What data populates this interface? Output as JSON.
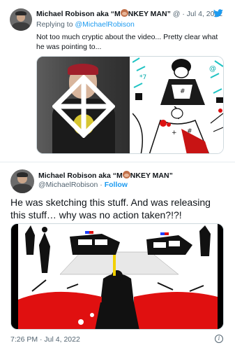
{
  "tweet1": {
    "author_name": "Michael Robison aka “M",
    "author_name_suffix": "NKEY MAN”",
    "handle": "@",
    "date": "· Jul 4, 2022",
    "replying_prefix": "Replying to ",
    "replying_to": "@MichaelRobison",
    "text": "Not too much cryptic about the video... Pretty clear what he was pointing to...",
    "media_icon_left": "octahedron-symbol"
  },
  "tweet2": {
    "author_name": "Michael Robison aka “M",
    "author_name_suffix": "NKEY MAN”",
    "handle": "@MichaelRobison",
    "separator": " · ",
    "follow_label": "Follow",
    "text": "He was sketching this stuff. And was releasing this stuff… why was no action taken?!?!",
    "time": "7:26 PM · Jul 4, 2022",
    "info_glyph": "i"
  },
  "colors": {
    "link": "#1d9bf0",
    "text": "#0f1419",
    "muted": "#536471",
    "red": "#e01010"
  }
}
